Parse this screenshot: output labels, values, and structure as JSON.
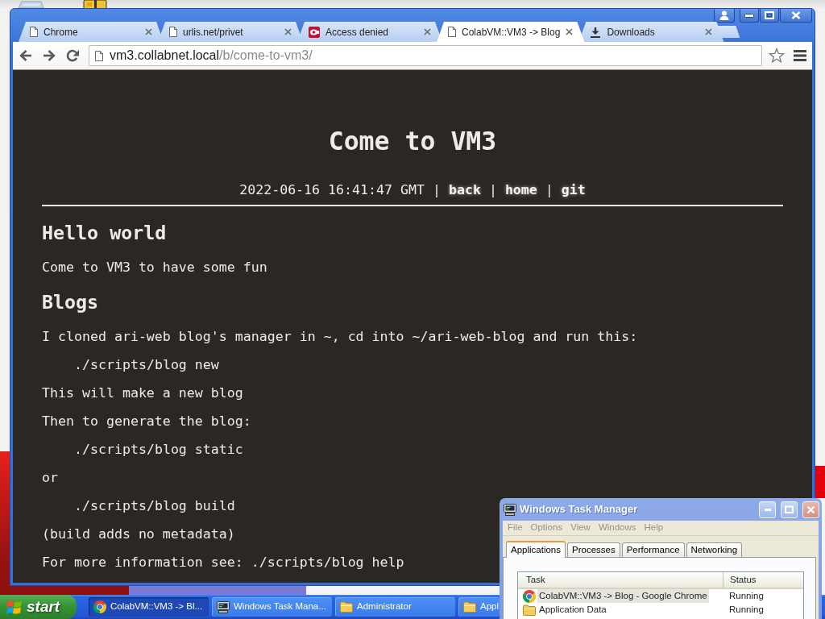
{
  "browser": {
    "active": true,
    "tabs": [
      {
        "kind": "page",
        "title": "Chrome",
        "selected": false
      },
      {
        "kind": "page",
        "title": "urlis.net/privet",
        "selected": false
      },
      {
        "kind": "blocked",
        "title": "Access denied",
        "selected": false
      },
      {
        "kind": "page",
        "title": "ColabVM::VM3 -> Blog",
        "selected": true
      },
      {
        "kind": "download",
        "title": "Downloads",
        "selected": false
      }
    ],
    "address": {
      "host": "vm3.collabnet.local",
      "path": "/b/come-to-vm3/"
    },
    "page": {
      "title": "Come to VM3",
      "timestamp": "2022-06-16 16:41:47 GMT",
      "links": [
        {
          "separator": "|",
          "label": "back"
        },
        {
          "separator": "|",
          "label": "home"
        },
        {
          "separator": "|",
          "label": "git"
        }
      ],
      "blocks": [
        {
          "kind": "heading",
          "text": "Hello world"
        },
        {
          "kind": "paragraph",
          "text": "Come to VM3 to have some fun"
        },
        {
          "kind": "heading",
          "text": "Blogs"
        },
        {
          "kind": "paragraph",
          "text": "I cloned ari-web blog's manager in ~, cd into ~/ari-web-blog and run this:"
        },
        {
          "kind": "code",
          "text": "./scripts/blog new"
        },
        {
          "kind": "paragraph",
          "text": "This will make a new blog"
        },
        {
          "kind": "paragraph",
          "text": "Then to generate the blog:"
        },
        {
          "kind": "code",
          "text": "./scripts/blog static"
        },
        {
          "kind": "paragraph",
          "text": "or"
        },
        {
          "kind": "code",
          "text": "./scripts/blog build"
        },
        {
          "kind": "paragraph",
          "text": "(build adds no metadata)"
        },
        {
          "kind": "paragraph",
          "text": "For more information see: ./scripts/blog help"
        }
      ]
    }
  },
  "task_manager": {
    "title": "Windows Task Manager",
    "active": false,
    "menu": [
      "File",
      "Options",
      "View",
      "Windows",
      "Help"
    ],
    "tabs": [
      {
        "label": "Applications",
        "selected": true
      },
      {
        "label": "Processes",
        "selected": false
      },
      {
        "label": "Performance",
        "selected": false
      },
      {
        "label": "Networking",
        "selected": false
      }
    ],
    "columns": [
      "Task",
      "Status"
    ],
    "rows": [
      {
        "kind": "browser",
        "task": "ColabVM::VM3 -> Blog - Google Chrome",
        "status": "Running",
        "selected": true
      },
      {
        "kind": "folder",
        "task": "Application Data",
        "status": "Running",
        "selected": false
      }
    ]
  },
  "taskbar": {
    "start": "start",
    "buttons": [
      {
        "kind": "browser",
        "label": "ColabVM::VM3 -> Bl...",
        "selected": true
      },
      {
        "kind": "taskmgr",
        "label": "Windows Task Mana...",
        "selected": false
      },
      {
        "kind": "folder",
        "label": "Administrator",
        "selected": false
      },
      {
        "kind": "folder",
        "label": "Appl",
        "selected": false
      }
    ]
  }
}
